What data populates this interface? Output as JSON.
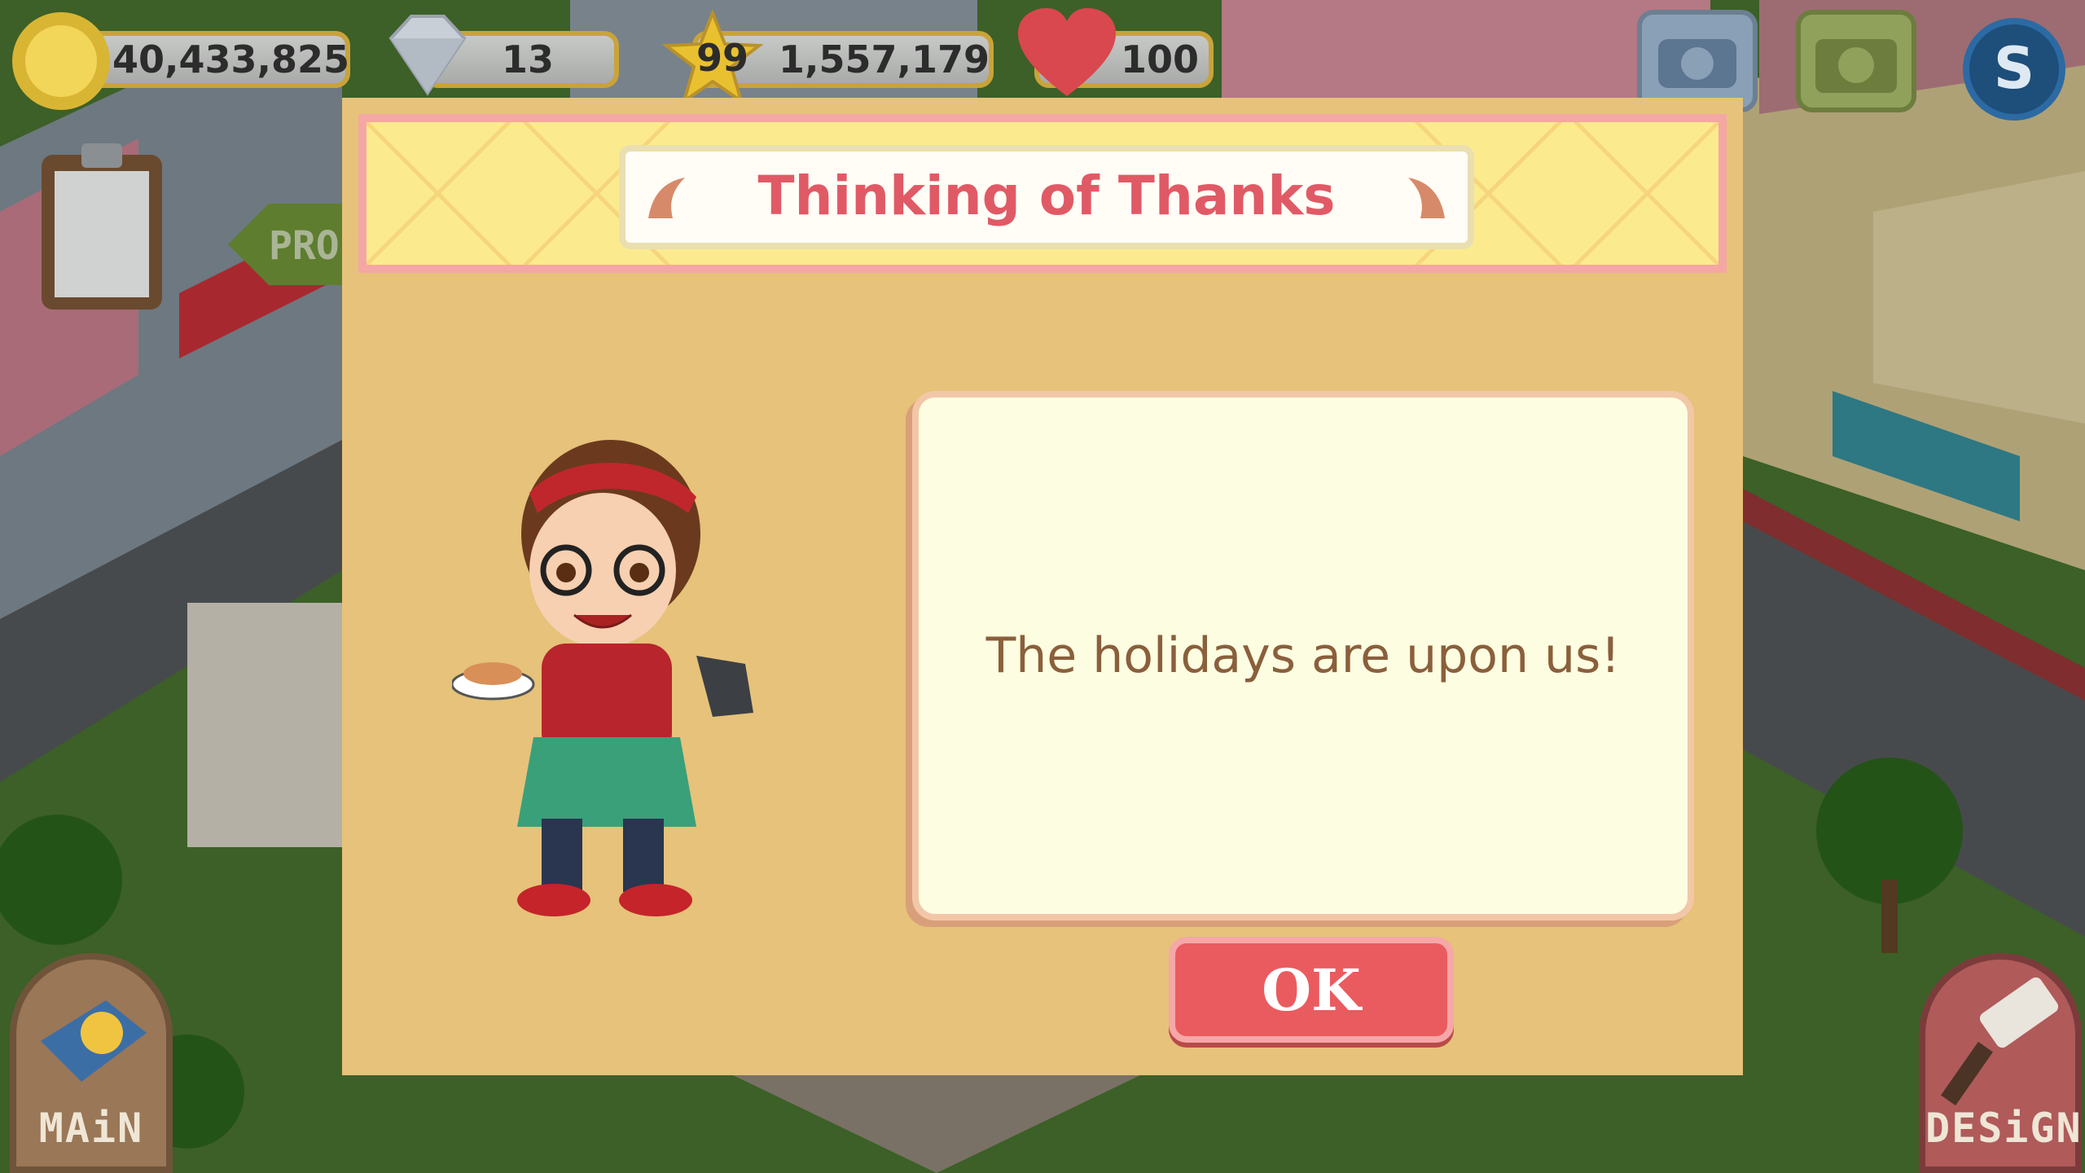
{
  "hud": {
    "coins": "40,433,825",
    "gems": "13",
    "level": "99",
    "xp": "1,557,179",
    "hearts": "100"
  },
  "background": {
    "sign_text": "PRO"
  },
  "side_buttons": {
    "main_label": "MAiN",
    "design_label": "DESiGN"
  },
  "dialog": {
    "title": "Thinking of Thanks",
    "message": "The holidays are upon us!",
    "ok_label": "OK"
  },
  "icons": {
    "coin": "coin-icon",
    "gem": "diamond-icon",
    "star": "star-icon",
    "heart": "heart-icon",
    "phone": "phone-icon",
    "camera": "camera-icon",
    "social": "s-icon",
    "clipboard": "clipboard-icon"
  },
  "colors": {
    "title": "#e05a66",
    "message": "#8a5f3c",
    "ok_button": "#ea5b5f",
    "dialog_bg": "#e6c27a",
    "banner_bg": "#fbeb8e"
  }
}
